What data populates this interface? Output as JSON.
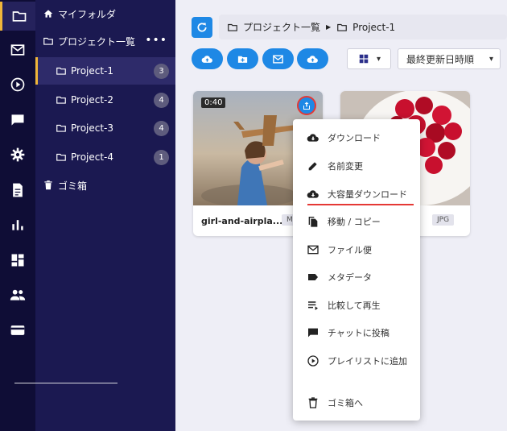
{
  "rail": {
    "items": [
      {
        "icon": "folder-icon"
      },
      {
        "icon": "mail-icon"
      },
      {
        "icon": "play-circle-icon"
      },
      {
        "icon": "chat-icon"
      },
      {
        "icon": "gear-icon"
      },
      {
        "icon": "document-icon"
      },
      {
        "icon": "bar-chart-icon"
      },
      {
        "icon": "dashboard-icon"
      },
      {
        "icon": "people-icon"
      },
      {
        "icon": "credit-card-icon"
      }
    ],
    "accent": "#f0b63a"
  },
  "tree": {
    "my_folder": "マイフォルダ",
    "project_list": "プロジェクト一覧",
    "more": "•••",
    "projects": [
      {
        "label": "Project-1",
        "count": "3"
      },
      {
        "label": "Project-2",
        "count": "4"
      },
      {
        "label": "Project-3",
        "count": "4"
      },
      {
        "label": "Project-4",
        "count": "1"
      }
    ],
    "trash": "ゴミ箱"
  },
  "breadcrumb": {
    "root": "プロジェクト一覧",
    "separator": "▶",
    "current": "Project-1"
  },
  "toolbar": {
    "sort_label": "最終更新日時順",
    "view_caret": "▾",
    "sort_caret": "▾",
    "brand_color": "#1e88e5"
  },
  "cards": [
    {
      "name": "girl-and-airpla...",
      "duration": "0:40",
      "type": "MP4"
    },
    {
      "name": "",
      "type": "JPG"
    }
  ],
  "menu": {
    "items": [
      {
        "label": "ダウンロード",
        "icon": "cloud-download-icon"
      },
      {
        "label": "名前変更",
        "icon": "pencil-icon"
      },
      {
        "label": "大容量ダウンロード",
        "icon": "cloud-download-icon"
      },
      {
        "label": "移動 / コピー",
        "icon": "copy-icon"
      },
      {
        "label": "ファイル便",
        "icon": "envelope-icon"
      },
      {
        "label": "メタデータ",
        "icon": "label-icon"
      },
      {
        "label": "比較して再生",
        "icon": "playlist-compare-icon"
      },
      {
        "label": "チャットに投稿",
        "icon": "chat-icon"
      },
      {
        "label": "プレイリストに追加",
        "icon": "play-circle-icon"
      },
      {
        "label": "ゴミ箱へ",
        "icon": "trash-icon"
      }
    ],
    "highlight_color": "#e53935"
  }
}
